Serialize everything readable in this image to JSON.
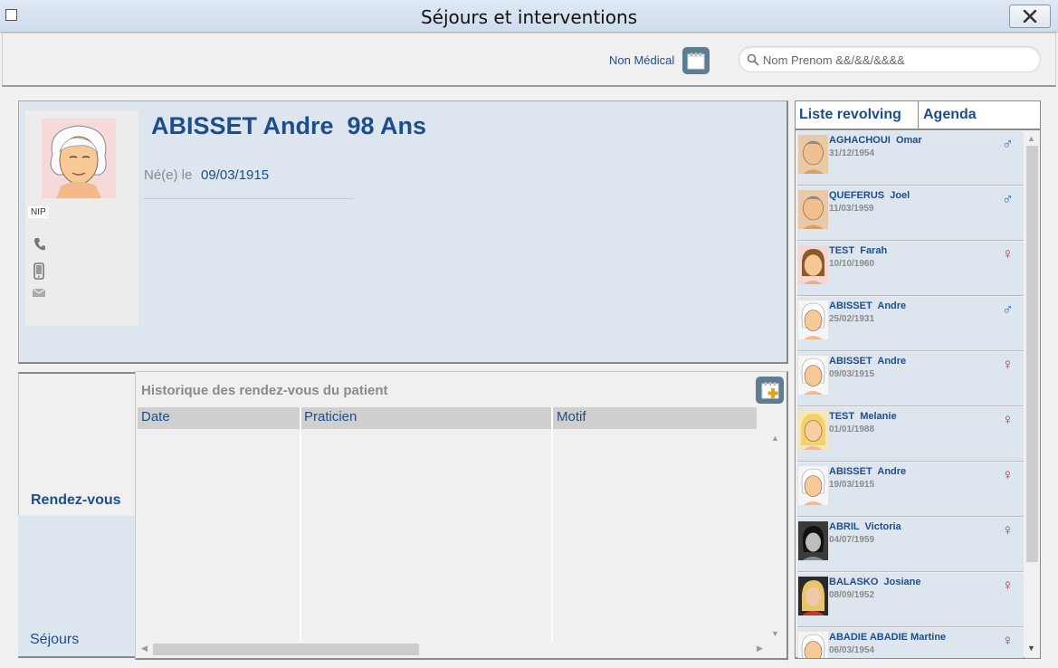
{
  "window": {
    "title": "Séjours et interventions"
  },
  "toolbar": {
    "non_medical_label": "Non Médical",
    "search_placeholder": "Nom Prenom &&/&&/&&&&"
  },
  "patient": {
    "name_age": "ABISSET Andre  98 Ans",
    "dob_label": "Né(e) le",
    "dob": "09/03/1915",
    "nip_label": "NIP"
  },
  "tabs": {
    "rendezvous": "Rendez-vous",
    "sejours": "Séjours"
  },
  "rdv": {
    "title": "Historique des rendez-vous du patient",
    "columns": [
      "Date",
      "Praticien",
      "Motif"
    ]
  },
  "right_tabs": {
    "revolving": "Liste revolving",
    "agenda": "Agenda"
  },
  "patients": [
    {
      "name": "AGHACHOUI  Omar",
      "date": "31/12/1954",
      "sex": "m",
      "sex_symbol": "♂"
    },
    {
      "name": "QUEFERUS  Joel",
      "date": "11/03/1959",
      "sex": "m",
      "sex_symbol": "♂"
    },
    {
      "name": "TEST  Farah",
      "date": "10/10/1960",
      "sex": "f",
      "sex_symbol": "♀"
    },
    {
      "name": "ABISSET  Andre",
      "date": "25/02/1931",
      "sex": "m",
      "sex_symbol": "♂"
    },
    {
      "name": "ABISSET  Andre",
      "date": "09/03/1915",
      "sex": "f",
      "sex_symbol": "♀"
    },
    {
      "name": "TEST  Melanie",
      "date": "01/01/1988",
      "sex": "f",
      "sex_symbol": "♀"
    },
    {
      "name": "ABISSET  Andre",
      "date": "19/03/1915",
      "sex": "f",
      "sex_symbol": "♀"
    },
    {
      "name": "ABRIL  Victoria",
      "date": "04/07/1959",
      "sex": "f",
      "sex_symbol": "♀"
    },
    {
      "name": "BALASKO  Josiane",
      "date": "08/09/1952",
      "sex": "f",
      "sex_symbol": "♀"
    },
    {
      "name": "ABADIE ABADIE Martine",
      "date": "06/03/1954",
      "sex": "f",
      "sex_symbol": "♀"
    }
  ],
  "colors": {
    "accent": "#1e4d8c",
    "male": "#2f68a8",
    "female": "#b03a4a",
    "panel": "#dde6ef"
  },
  "icons": [
    "calendar-icon",
    "search-icon",
    "close-icon",
    "phone-icon",
    "mobile-icon",
    "mail-icon",
    "calendar-add-icon"
  ]
}
